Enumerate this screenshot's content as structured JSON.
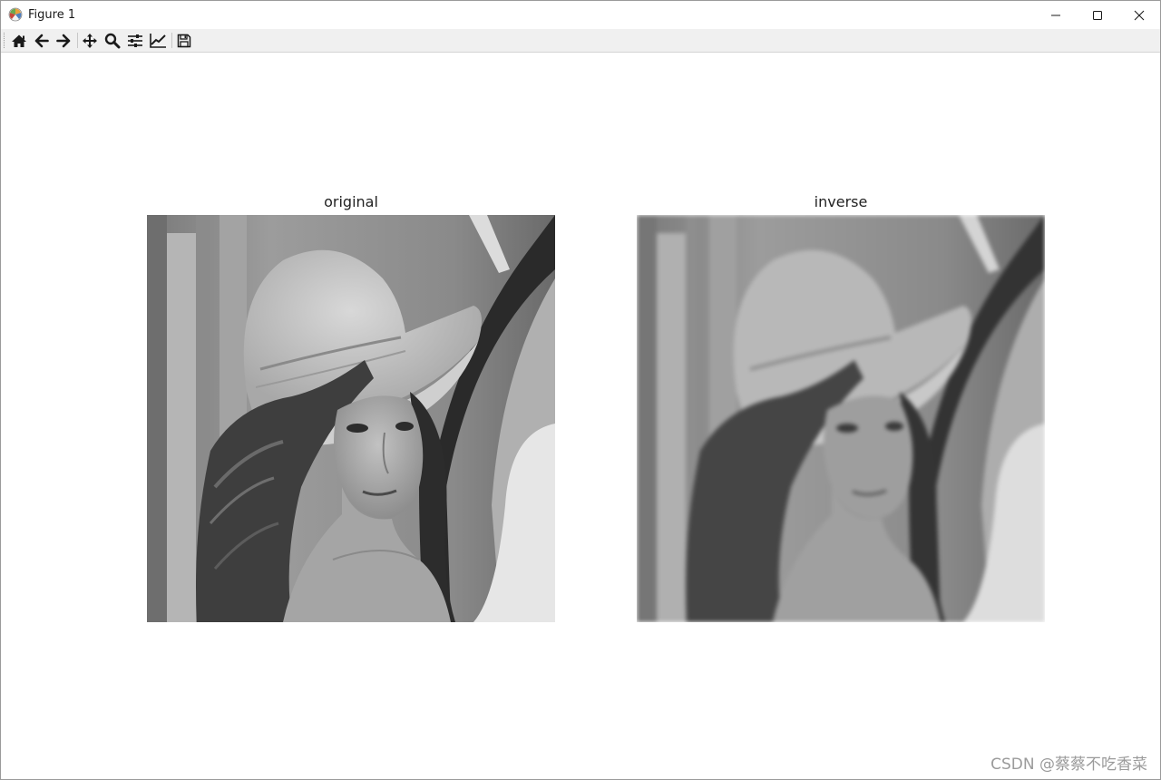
{
  "window": {
    "title": "Figure 1",
    "controls": [
      "minimize",
      "maximize",
      "close"
    ]
  },
  "toolbar": {
    "buttons": [
      {
        "icon": "home-icon"
      },
      {
        "icon": "back-arrow-icon"
      },
      {
        "icon": "forward-arrow-icon"
      },
      {
        "icon": "pan-move-icon"
      },
      {
        "icon": "zoom-magnifier-icon"
      },
      {
        "icon": "configure-subplots-icon"
      },
      {
        "icon": "edit-axis-icon"
      },
      {
        "icon": "save-floppy-icon"
      }
    ]
  },
  "figure": {
    "subplots": [
      {
        "title": "original"
      },
      {
        "title": "inverse"
      }
    ]
  },
  "watermark": "CSDN @蔡蔡不吃香菜"
}
